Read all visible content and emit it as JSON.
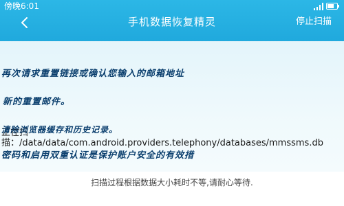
{
  "status_bar": {
    "time": "傍晚6:01",
    "battery_level": 0.7,
    "signal": "signal-icon",
    "battery": "battery-icon"
  },
  "header": {
    "back_icon": "chevron-left-icon",
    "title": "手机数据恢复精灵",
    "stop_scan_label": "停止扫描"
  },
  "overlay": {
    "line1": "再次请求重置链接或确认您输入的邮箱地址",
    "line2": "新的重置邮件。",
    "line3": "清除浏览器缓存和历史记录。",
    "line4": "密码和启用双重认证是保护账户安全的有效措"
  },
  "scan": {
    "current_path": "正在扫描：/data/data/com.android.providers.telephony/databases/mmssms.db"
  },
  "footer": {
    "note": "扫描过程根据数据大小耗时不等,请耐心等待."
  },
  "colors": {
    "accent": "#20a9dd",
    "overlay_text": "#0b3f6e"
  }
}
